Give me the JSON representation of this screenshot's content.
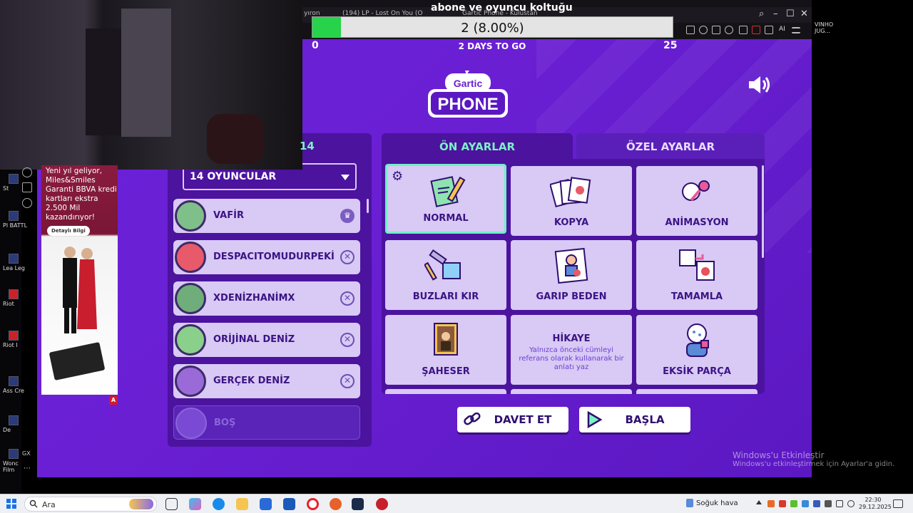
{
  "overlay": {
    "title": "abone ve oyuncu koltuğu",
    "progress_text": "2 (8.00%)",
    "progress_fraction": 0.08,
    "start_value": "0",
    "goal_value": "25",
    "days_left": "2 DAYS TO GO"
  },
  "browser": {
    "tabs": [
      "yıron",
      "(194) LP - Lost On You (O",
      "Gartic Phone - Kulustan"
    ],
    "right_text": "VINHO JUG...",
    "ai_label": "AI"
  },
  "game": {
    "player_panel_fragment": "14",
    "player_count_select": "14 OYUNCULAR",
    "players": [
      {
        "name": "VAFİR",
        "action": "crown"
      },
      {
        "name": "DESPACITOMUDURPEKİ",
        "action": "kick"
      },
      {
        "name": "XDENİZHANİMX",
        "action": "kick"
      },
      {
        "name": "ORİJİNAL DENİZ",
        "action": "kick"
      },
      {
        "name": "GERÇEK DENİZ",
        "action": "kick"
      }
    ],
    "empty_slot": "BOŞ",
    "tabs": {
      "presets": "ÖN AYARLAR",
      "custom": "ÖZEL AYARLAR"
    },
    "modes": [
      {
        "label": "NORMAL",
        "icon": "notepad-pencil-icon",
        "selected": true
      },
      {
        "label": "KOPYA",
        "icon": "cards-icon",
        "selected": false
      },
      {
        "label": "ANİMASYON",
        "icon": "animation-icon",
        "selected": false
      },
      {
        "label": "BUZLARI KIR",
        "icon": "ice-hammer-icon",
        "selected": false
      },
      {
        "label": "GARIP BEDEN",
        "icon": "portrait-icon",
        "selected": false
      },
      {
        "label": "TAMAMLA",
        "icon": "puzzle-icon",
        "selected": false
      },
      {
        "label": "ŞAHESER",
        "icon": "mona-lisa-icon",
        "selected": false
      },
      {
        "label": "HİKAYE",
        "icon": "story-icon",
        "selected": false,
        "description": "Yalnızca önceki cümleyi referans olarak kullanarak bir anlatı yaz"
      },
      {
        "label": "EKSİK PARÇA",
        "icon": "missing-piece-icon",
        "selected": false
      }
    ],
    "invite_button": "DAVET ET",
    "start_button": "BAŞLA"
  },
  "ad": {
    "text": "Yeni yıl geliyor, Miles&Smiles Garanti BBVA kredi kartları ekstra 2.500 Mil kazandırıyor!",
    "button": "Detaylı Bilgi"
  },
  "desktop_icons": [
    "St",
    "Pl BATTL",
    "Lea Leg",
    "Riot",
    "Riot I",
    "Ass Cre",
    "De",
    "Wonc Film"
  ],
  "watermark": {
    "line1": "Windows'u Etkinleştir",
    "line2": "Windows'u etkinleştirmek için Ayarlar'a gidin."
  },
  "taskbar": {
    "search_placeholder": "Ara",
    "weather": "Soğuk hava",
    "time": "22:30",
    "date": "29.12.2025"
  },
  "colors": {
    "game_bg": "#6a1fd3",
    "panel": "#4b139e",
    "card": "#d8c9f5",
    "accent_green": "#6ff0c8",
    "progress_green": "#27d34a"
  }
}
